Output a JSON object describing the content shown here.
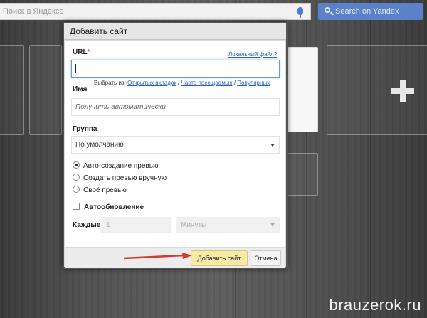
{
  "search": {
    "placeholder": "Поиск в Яндексе",
    "button_label": "Search on Yandex"
  },
  "dialog": {
    "title": "Добавить сайт",
    "url": {
      "label": "URL",
      "required_mark": "*",
      "value": "",
      "local_file_link": "Локальный файл?"
    },
    "hint": {
      "prefix": "Выбрать из:",
      "options": [
        "Открытых вкладок",
        "Часто посещаемых",
        "Популярных"
      ],
      "separator": " / "
    },
    "name": {
      "label": "Имя",
      "placeholder": "Получить автоматически"
    },
    "group": {
      "label": "Группа",
      "selected": "По умолчанию"
    },
    "preview_options": [
      {
        "label": "Авто-создание превью",
        "selected": true
      },
      {
        "label": "Создать превью вручную",
        "selected": false
      },
      {
        "label": "Своё превью",
        "selected": false
      }
    ],
    "auto_refresh": {
      "label": "Автообновление",
      "checked": false
    },
    "interval": {
      "label": "Каждые",
      "value": "1",
      "unit": "Минуты"
    },
    "buttons": {
      "add": "Добавить сайт",
      "cancel": "Отмена"
    }
  },
  "watermark": "brauzerok.ru",
  "colors": {
    "accent_link": "#2b5fc6",
    "primary_button": "#f7e9a6",
    "arrow": "#d23a2a",
    "focus": "#5d9be5"
  }
}
